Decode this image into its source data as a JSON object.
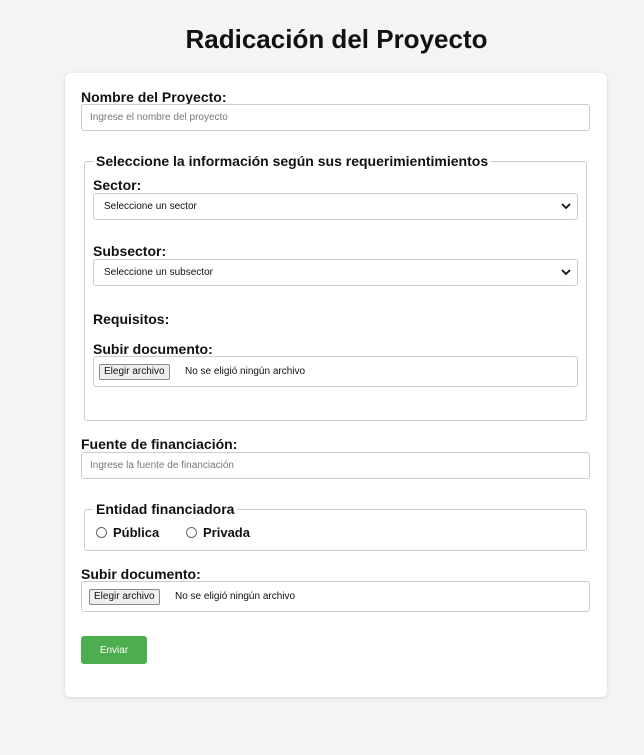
{
  "page": {
    "title": "Radicación del Proyecto"
  },
  "form": {
    "project_name": {
      "label": "Nombre del Proyecto:",
      "placeholder": "Ingrese el nombre del proyecto"
    },
    "requirements": {
      "legend": "Seleccione la información según sus requerimientimientos",
      "sector": {
        "label": "Sector:",
        "selected": "Seleccione un sector"
      },
      "subsector": {
        "label": "Subsector:",
        "selected": "Seleccione un subsector"
      },
      "requisitos_label": "Requisitos:",
      "upload": {
        "label": "Subir documento:",
        "button": "Elegir archivo",
        "status": "No se eligió ningún archivo"
      }
    },
    "funding_source": {
      "label": "Fuente de financiación:",
      "placeholder": "Ingrese la fuente de financiación"
    },
    "entity": {
      "legend": "Entidad financiadora",
      "options": [
        "Pública",
        "Privada"
      ]
    },
    "upload": {
      "label": "Subir documento:",
      "button": "Elegir archivo",
      "status": "No se eligió ningún archivo"
    },
    "submit_label": "Enviar"
  }
}
